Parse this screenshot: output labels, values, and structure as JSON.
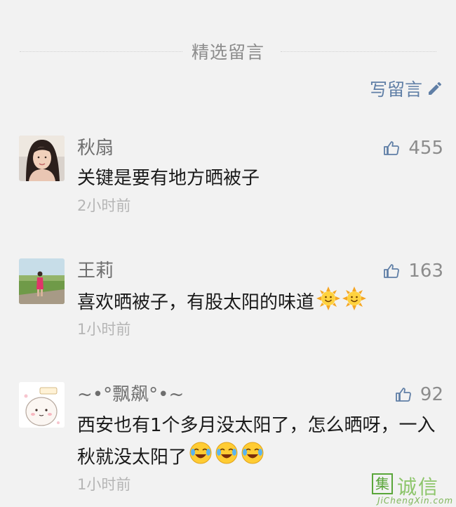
{
  "section": {
    "title": "精选留言"
  },
  "write": {
    "label": "写留言"
  },
  "comments": [
    {
      "name": "秋扇",
      "likes": "455",
      "text": "关键是要有地方晒被子",
      "time": "2小时前"
    },
    {
      "name": "王莉",
      "likes": "163",
      "text": "喜欢晒被子，有股太阳的味道",
      "time": "1小时前",
      "emoji": [
        "sun-emoji",
        "sun-emoji"
      ]
    },
    {
      "name": "~•°飘飙°•~",
      "likes": "92",
      "text": "西安也有1个多月没太阳了，怎么晒呀，一入秋就没太阳了",
      "time": "1小时前",
      "emoji": [
        "crying-laughing-emoji",
        "crying-laughing-emoji",
        "crying-laughing-emoji"
      ]
    }
  ],
  "watermark": {
    "logo_char": "集",
    "text": "诚信",
    "url": "JiChengXin.com"
  },
  "colors": {
    "link": "#607fa6",
    "muted": "#8c8c8c",
    "time": "#b5b5b5",
    "background": "#f2f2f2"
  }
}
